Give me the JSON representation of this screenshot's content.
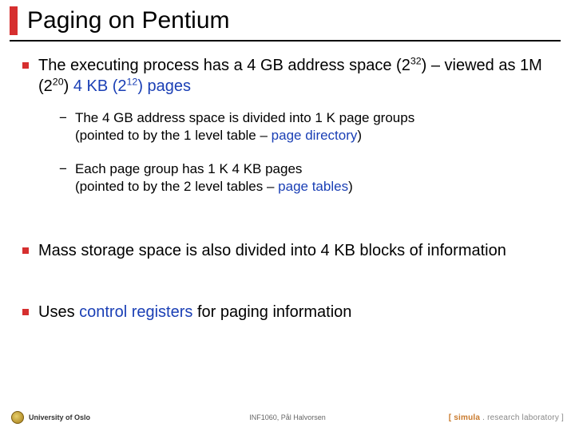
{
  "title": "Paging on Pentium",
  "bullets": {
    "b1_pre": "The executing process has a 4 GB address space (2",
    "b1_sup1": "32",
    "b1_mid1": ") – viewed as 1M (2",
    "b1_sup2": "20",
    "b1_mid2": ") ",
    "b1_blue": "4 KB (2",
    "b1_blue_sup": "12",
    "b1_blue_end": ") pages",
    "sub1_a": "The 4 GB address space is divided into 1 K page groups",
    "sub1_b": "(pointed to by the 1 level table – ",
    "sub1_blue": "page directory",
    "sub1_c": ")",
    "sub2_a": "Each page group has 1 K 4 KB pages",
    "sub2_b": "(pointed to by the 2 level tables – ",
    "sub2_blue": "page tables",
    "sub2_c": ")",
    "b2": "Mass storage space is also divided into 4 KB blocks of information",
    "b3_a": "Uses ",
    "b3_blue": "control registers",
    "b3_b": " for paging information"
  },
  "footer": {
    "left": "University of Oslo",
    "mid": "INF1060,   Pål Halvorsen",
    "right_lb": "[ ",
    "right_brand": "simula",
    "right_rest": " . research laboratory ]"
  }
}
